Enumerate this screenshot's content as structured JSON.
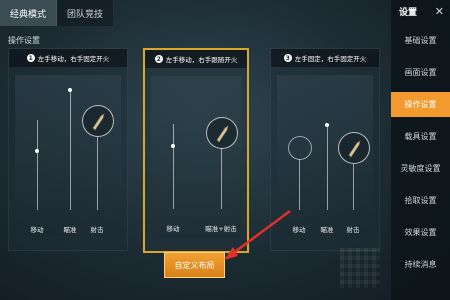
{
  "tabs": [
    "经典模式",
    "团队竞技"
  ],
  "section_title": "操作设置",
  "panels": [
    {
      "number": "1",
      "title": "左手移动，右手固定开火",
      "labels": [
        "移动",
        "瞄准",
        "射击"
      ]
    },
    {
      "number": "2",
      "title": "左手移动，右手跟随开火",
      "labels": [
        "移动",
        "瞄准+射击"
      ]
    },
    {
      "number": "3",
      "title": "左手固定，右手固定开火",
      "labels": [
        "移动",
        "瞄准",
        "射击"
      ]
    }
  ],
  "custom_layout_button": "自定义布局",
  "sidebar": {
    "title": "设置",
    "close_icon": "✕",
    "items": [
      "基础设置",
      "画面设置",
      "操作设置",
      "载具设置",
      "灵敏度设置",
      "拾取设置",
      "效果设置",
      "持续消息"
    ]
  },
  "colors": {
    "accent": "#f39a2e",
    "selected_border": "#d9a72a"
  },
  "icons": [
    "close-icon",
    "bullet-icon",
    "number-badge-icon",
    "arrow-annotation-icon"
  ]
}
